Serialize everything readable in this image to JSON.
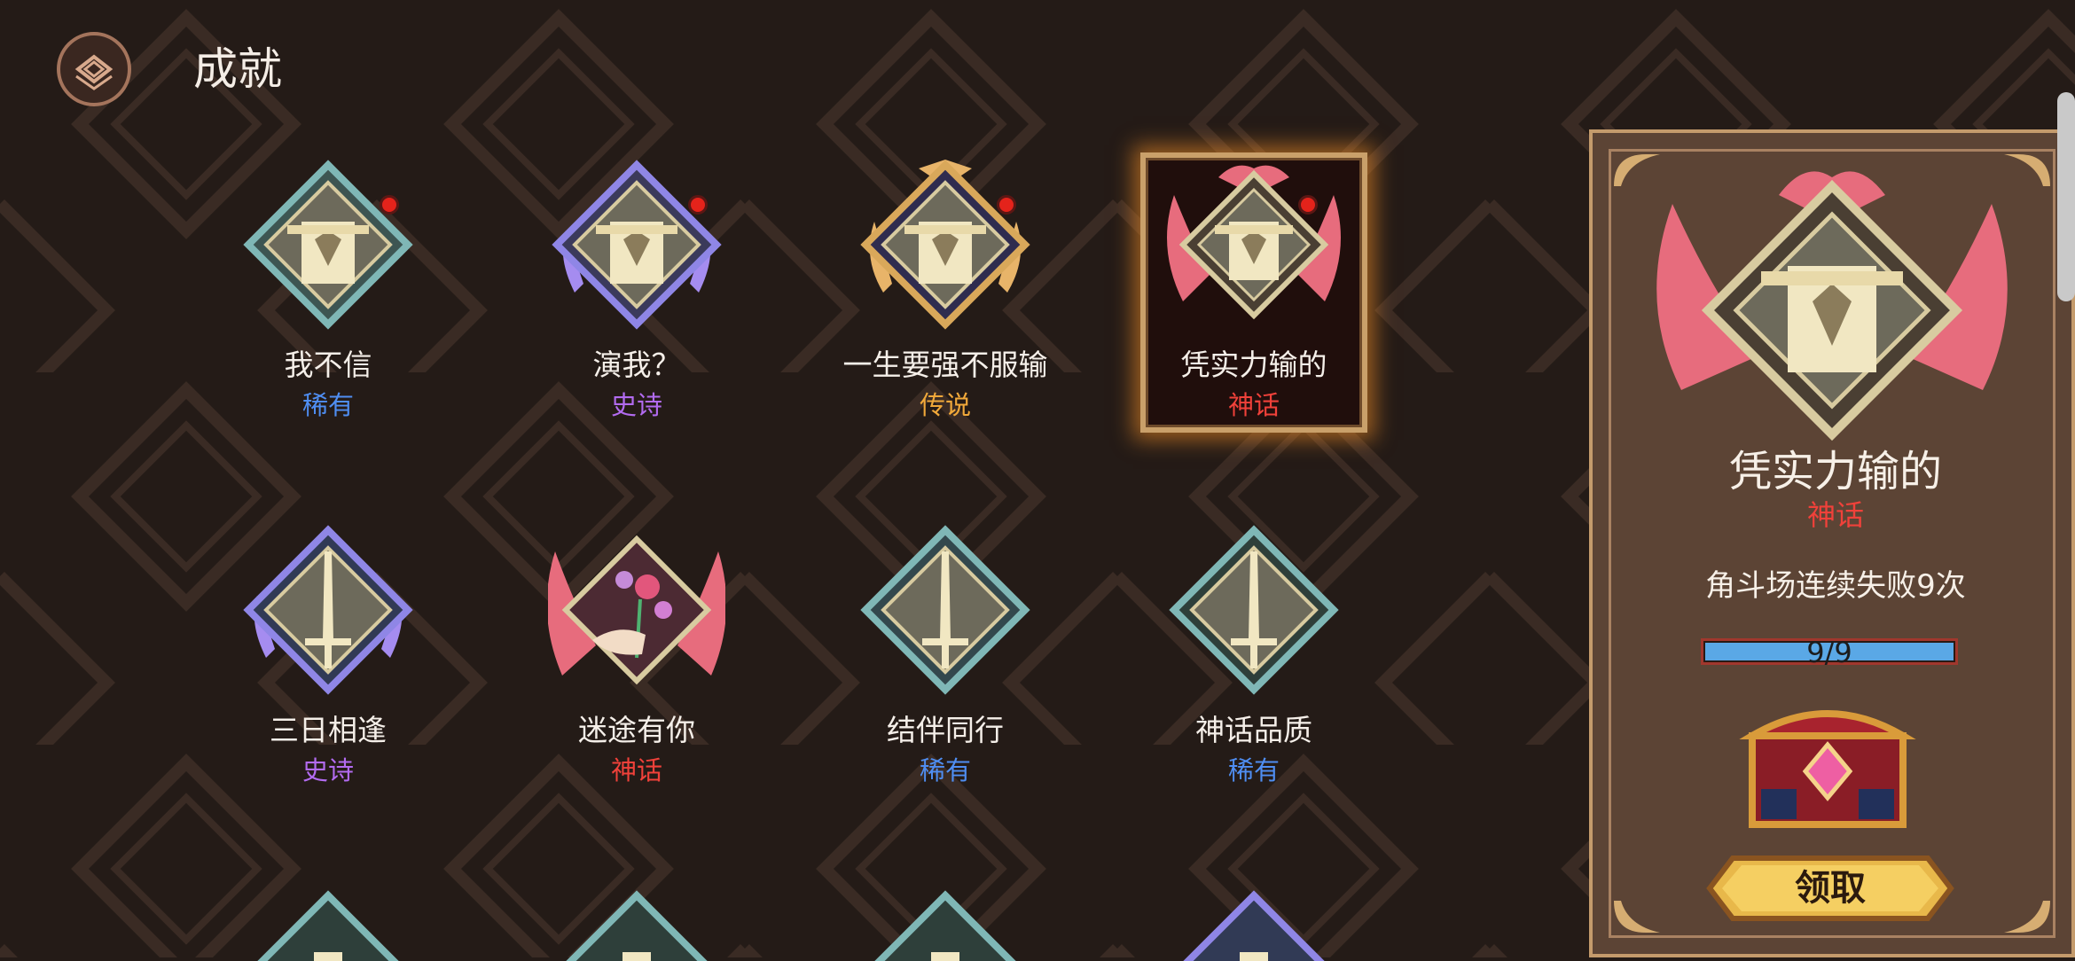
{
  "header": {
    "title": "成就"
  },
  "icons": {
    "back": "back-arrow-icon"
  },
  "colors": {
    "rare": "#4f8ef2",
    "epic": "#b26bf0",
    "legendary": "#f0a83a",
    "mythic": "#f0413a",
    "background": "#241b17"
  },
  "achievements": [
    {
      "name": "我不信",
      "rarity": "稀有",
      "new": true
    },
    {
      "name": "演我？",
      "rarity": "史诗",
      "new": true
    },
    {
      "name": "一生要强不服输",
      "rarity": "传说",
      "new": true
    },
    {
      "name": "凭实力输的",
      "rarity": "神话",
      "new": true,
      "selected": true
    },
    {
      "name": "三日相逢",
      "rarity": "史诗",
      "new": false
    },
    {
      "name": "迷途有你",
      "rarity": "神话",
      "new": false
    },
    {
      "name": "结伴同行",
      "rarity": "稀有",
      "new": false
    },
    {
      "name": "神话品质",
      "rarity": "稀有",
      "new": false
    }
  ],
  "detail": {
    "title": "凭实力输的",
    "rarity": "神话",
    "description": "角斗场连续失败9次",
    "progress_text": "9/9",
    "progress": 1.0,
    "claim_label": "领取"
  }
}
